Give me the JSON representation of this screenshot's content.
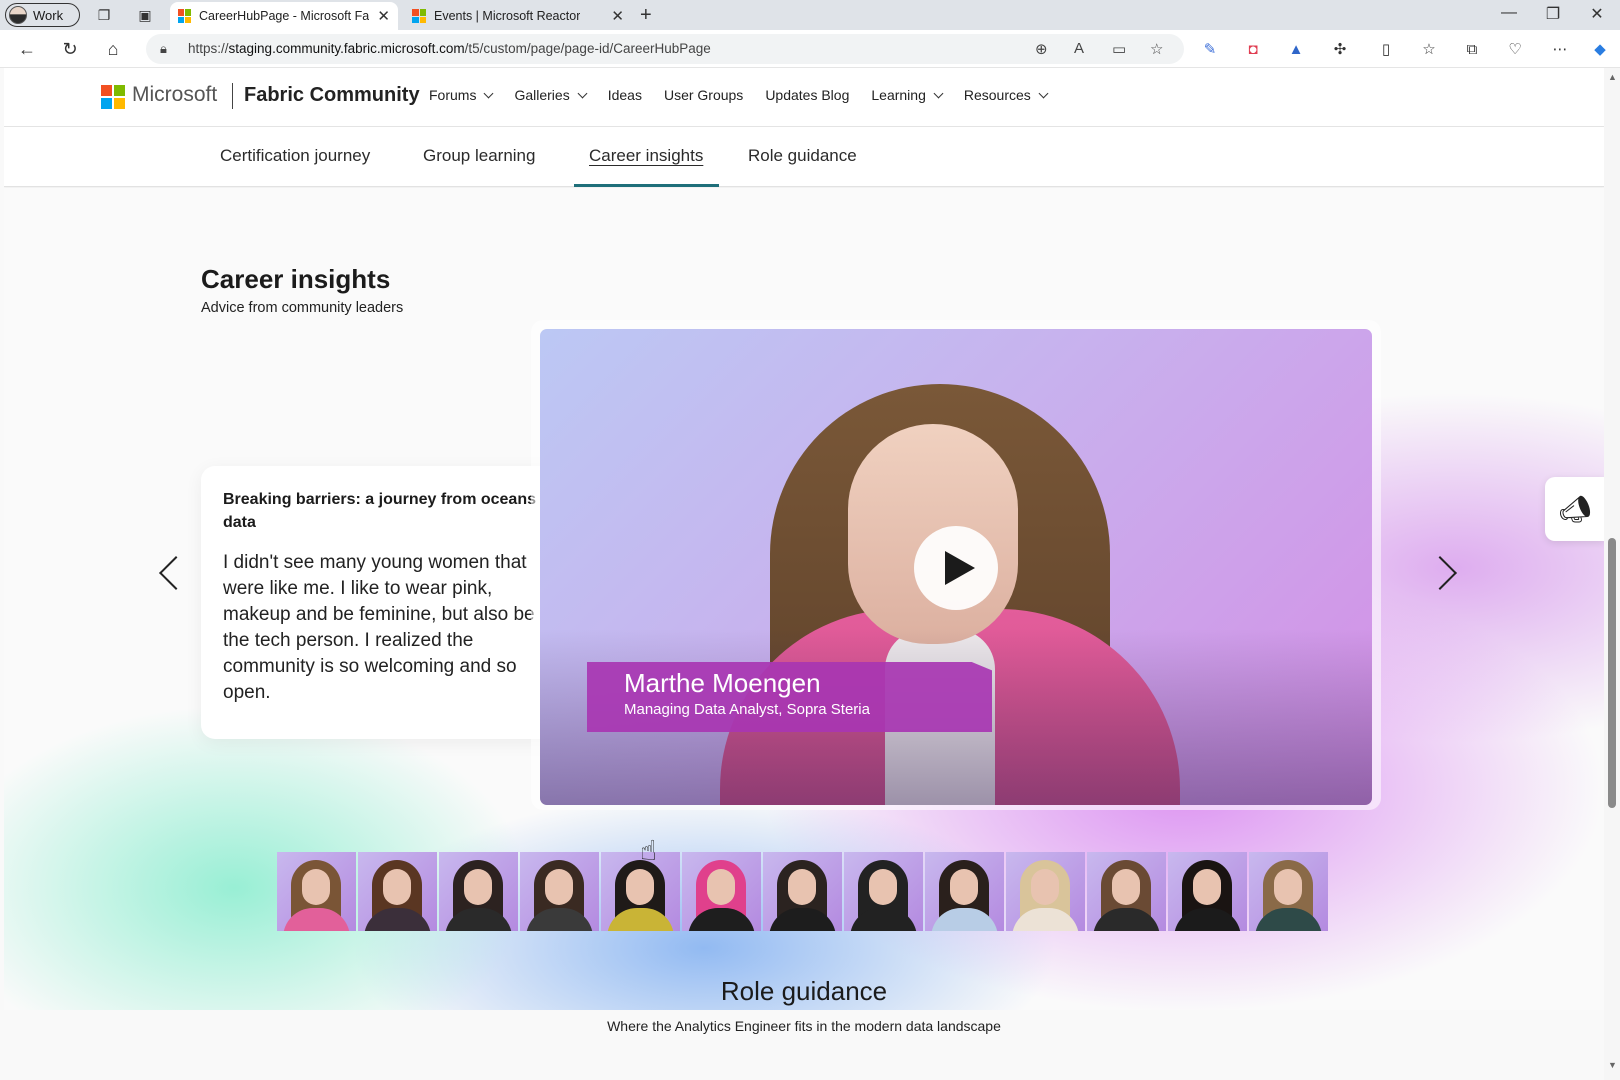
{
  "browser": {
    "profile_label": "Work",
    "tabs": [
      {
        "title": "CareerHubPage - Microsoft Fabri",
        "active": true
      },
      {
        "title": "Events | Microsoft Reactor",
        "active": false
      }
    ],
    "url_prefix": "https://",
    "url_host": "staging.community.fabric.microsoft.com",
    "url_path": "/t5/custom/page/page-id/CareerHubPage"
  },
  "site": {
    "brand": "Microsoft",
    "name": "Fabric Community",
    "nav": [
      {
        "label": "Forums",
        "dropdown": true
      },
      {
        "label": "Galleries",
        "dropdown": true
      },
      {
        "label": "Ideas",
        "dropdown": false
      },
      {
        "label": "User Groups",
        "dropdown": false
      },
      {
        "label": "Updates Blog",
        "dropdown": false
      },
      {
        "label": "Learning",
        "dropdown": true
      },
      {
        "label": "Resources",
        "dropdown": true
      }
    ]
  },
  "subnav": {
    "items": [
      "Certification journey",
      "Group learning",
      "Career insights",
      "Role guidance"
    ],
    "active": "Career insights"
  },
  "career": {
    "title": "Career insights",
    "subtitle": "Advice from community leaders",
    "quote_heading": "Breaking barriers: a journey from oceans to data",
    "quote_body": "I didn't see many young women that were like me. I like to wear pink, makeup and be feminine, but also be the tech person. I realized the community is so welcoming and so open.",
    "video": {
      "name": "Marthe Moengen",
      "role": "Managing Data Analyst, Sopra Steria"
    },
    "thumbnail_count": 13,
    "thumbnails": [
      {
        "hair": "#7a5536",
        "top": "#e2609a"
      },
      {
        "hair": "#5a3622",
        "top": "#3b2f3a"
      },
      {
        "hair": "#2c2220",
        "top": "#2a2a2a"
      },
      {
        "hair": "#3a2a22",
        "top": "#3a3a3a"
      },
      {
        "hair": "#1f1a18",
        "top": "#c9b436"
      },
      {
        "hair": "#e0408c",
        "top": "#1e1e1e"
      },
      {
        "hair": "#2b2320",
        "top": "#1d1d1d"
      },
      {
        "hair": "#222222",
        "top": "#222222"
      },
      {
        "hair": "#2a201c",
        "top": "#b8cde6"
      },
      {
        "hair": "#d9c49a",
        "top": "#ece2d6"
      },
      {
        "hair": "#6a4a34",
        "top": "#2a2a2a"
      },
      {
        "hair": "#1a1412",
        "top": "#1b1b1b"
      },
      {
        "hair": "#8a6a48",
        "top": "#2e4a48"
      }
    ]
  },
  "role": {
    "title": "Role guidance",
    "subtitle": "Where the Analytics Engineer fits in the modern data landscape"
  }
}
